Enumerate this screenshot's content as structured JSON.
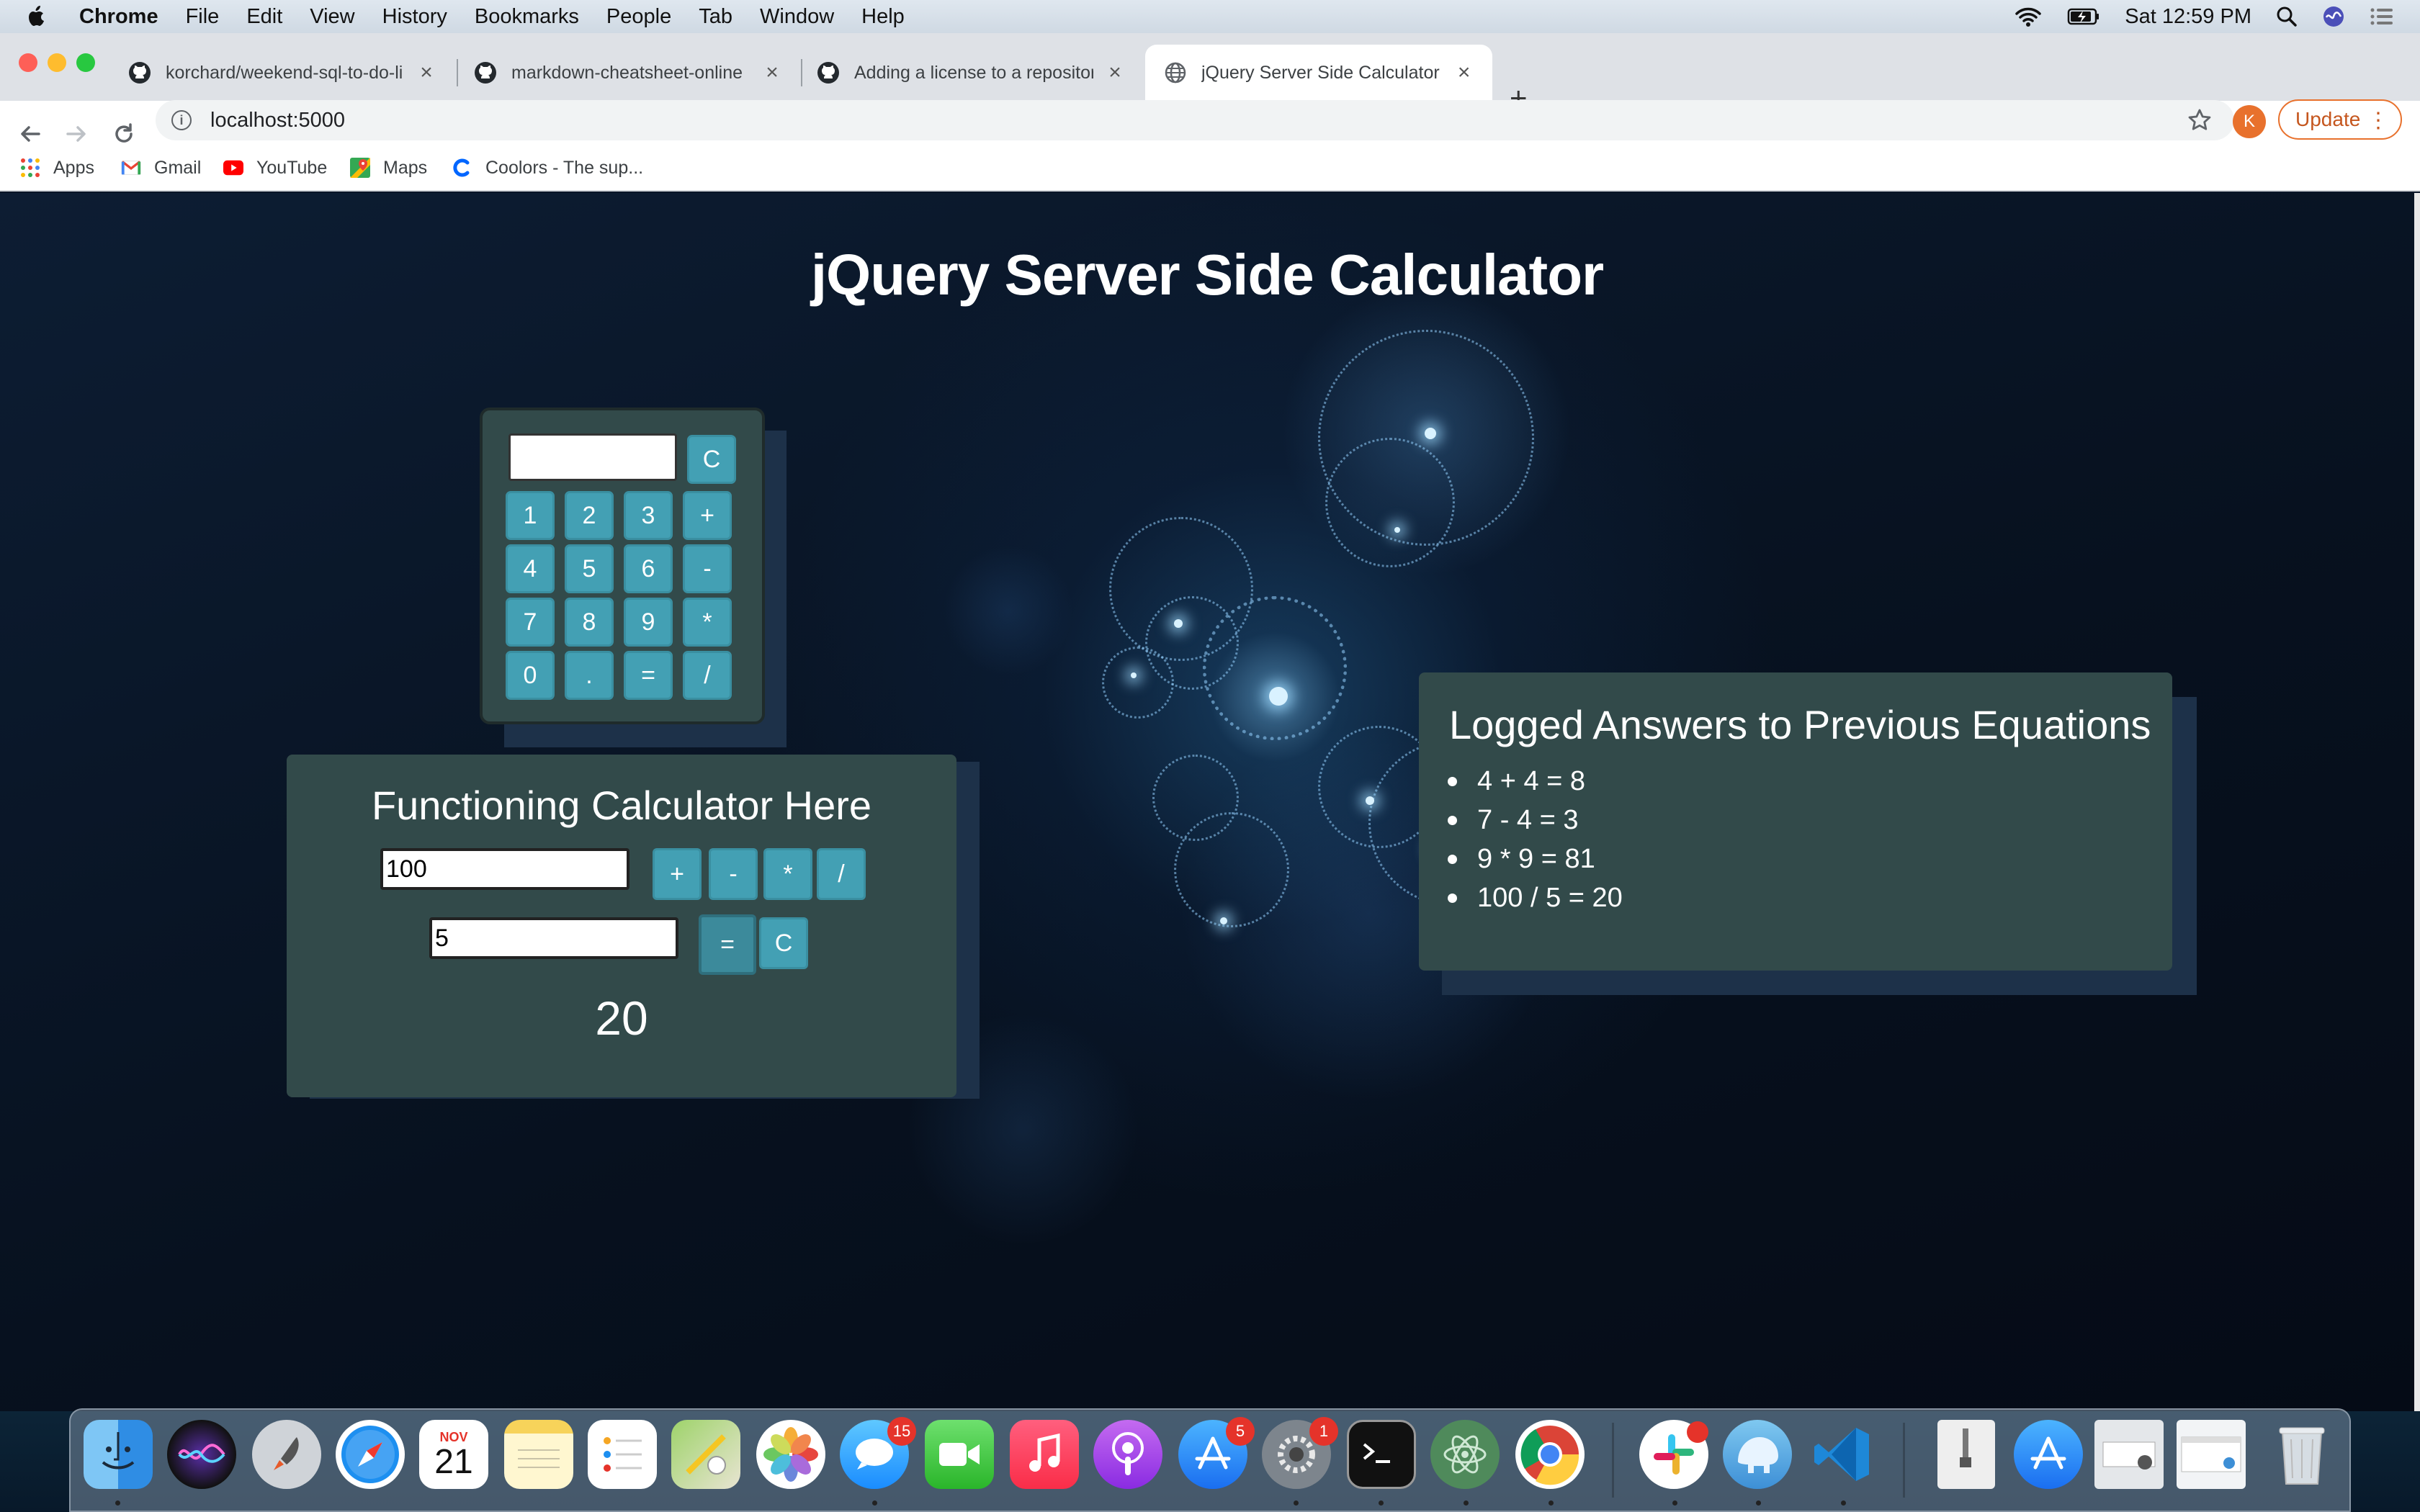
{
  "menubar": {
    "app_name": "Chrome",
    "items": [
      "File",
      "Edit",
      "View",
      "History",
      "Bookmarks",
      "People",
      "Tab",
      "Window",
      "Help"
    ],
    "clock": "Sat 12:59 PM"
  },
  "tabs": [
    {
      "title": "korchard/weekend-sql-to-do-li",
      "icon": "github-icon",
      "active": false
    },
    {
      "title": "markdown-cheatsheet-online",
      "icon": "github-icon",
      "active": false
    },
    {
      "title": "Adding a license to a repositor",
      "icon": "github-icon",
      "active": false
    },
    {
      "title": "jQuery Server Side Calculator",
      "icon": "globe-icon",
      "active": true
    }
  ],
  "toolbar": {
    "url": "localhost:5000",
    "profile_initial": "K",
    "update_label": "Update"
  },
  "bookmarks": [
    {
      "label": "Apps",
      "icon": "apps-grid-icon"
    },
    {
      "label": "Gmail",
      "icon": "gmail-icon"
    },
    {
      "label": "YouTube",
      "icon": "youtube-icon"
    },
    {
      "label": "Maps",
      "icon": "maps-icon"
    },
    {
      "label": "Coolors - The sup...",
      "icon": "coolors-icon"
    }
  ],
  "page": {
    "title": "jQuery Server Side Calculator"
  },
  "keypad": {
    "display_value": "",
    "clear_label": "C",
    "keys": [
      "1",
      "2",
      "3",
      "+",
      "4",
      "5",
      "6",
      "-",
      "7",
      "8",
      "9",
      "*",
      "0",
      ".",
      "=",
      "/"
    ]
  },
  "functioning_calculator": {
    "title": "Functioning Calculator Here",
    "first_number": "100",
    "second_number": "5",
    "operators": [
      "+",
      "-",
      "*",
      "/"
    ],
    "equals_label": "=",
    "clear_label": "C",
    "result": "20"
  },
  "log": {
    "title": "Logged Answers to Previous Equations",
    "entries": [
      "4 + 4 = 8",
      "7 - 4 = 3",
      "9 * 9 = 81",
      "100 / 5 = 20"
    ]
  },
  "dock": {
    "calendar_month": "NOV",
    "calendar_day": "21",
    "badges": {
      "messages": "15",
      "app_store": "5",
      "system_preferences": "1"
    },
    "apps": [
      "finder-icon",
      "siri-icon",
      "launchpad-icon",
      "safari-icon",
      "calendar-icon",
      "notes-icon",
      "reminders-icon",
      "maps-icon",
      "photos-icon",
      "messages-icon",
      "facetime-icon",
      "music-icon",
      "podcasts-icon",
      "app-store-icon",
      "system-preferences-icon",
      "terminal-icon",
      "atom-icon",
      "chrome-icon",
      "slack-icon",
      "tableplus-icon",
      "vscode-icon",
      "archive-icon",
      "app-store-download-icon",
      "screenshot-icon",
      "window-icon",
      "trash-icon"
    ]
  },
  "colors": {
    "card_bg": "#324a4a",
    "button_bg": "#43a0b4",
    "card_shadow": "#1d3149",
    "page_bg": "#0a1628",
    "update_accent": "#e8712d"
  }
}
